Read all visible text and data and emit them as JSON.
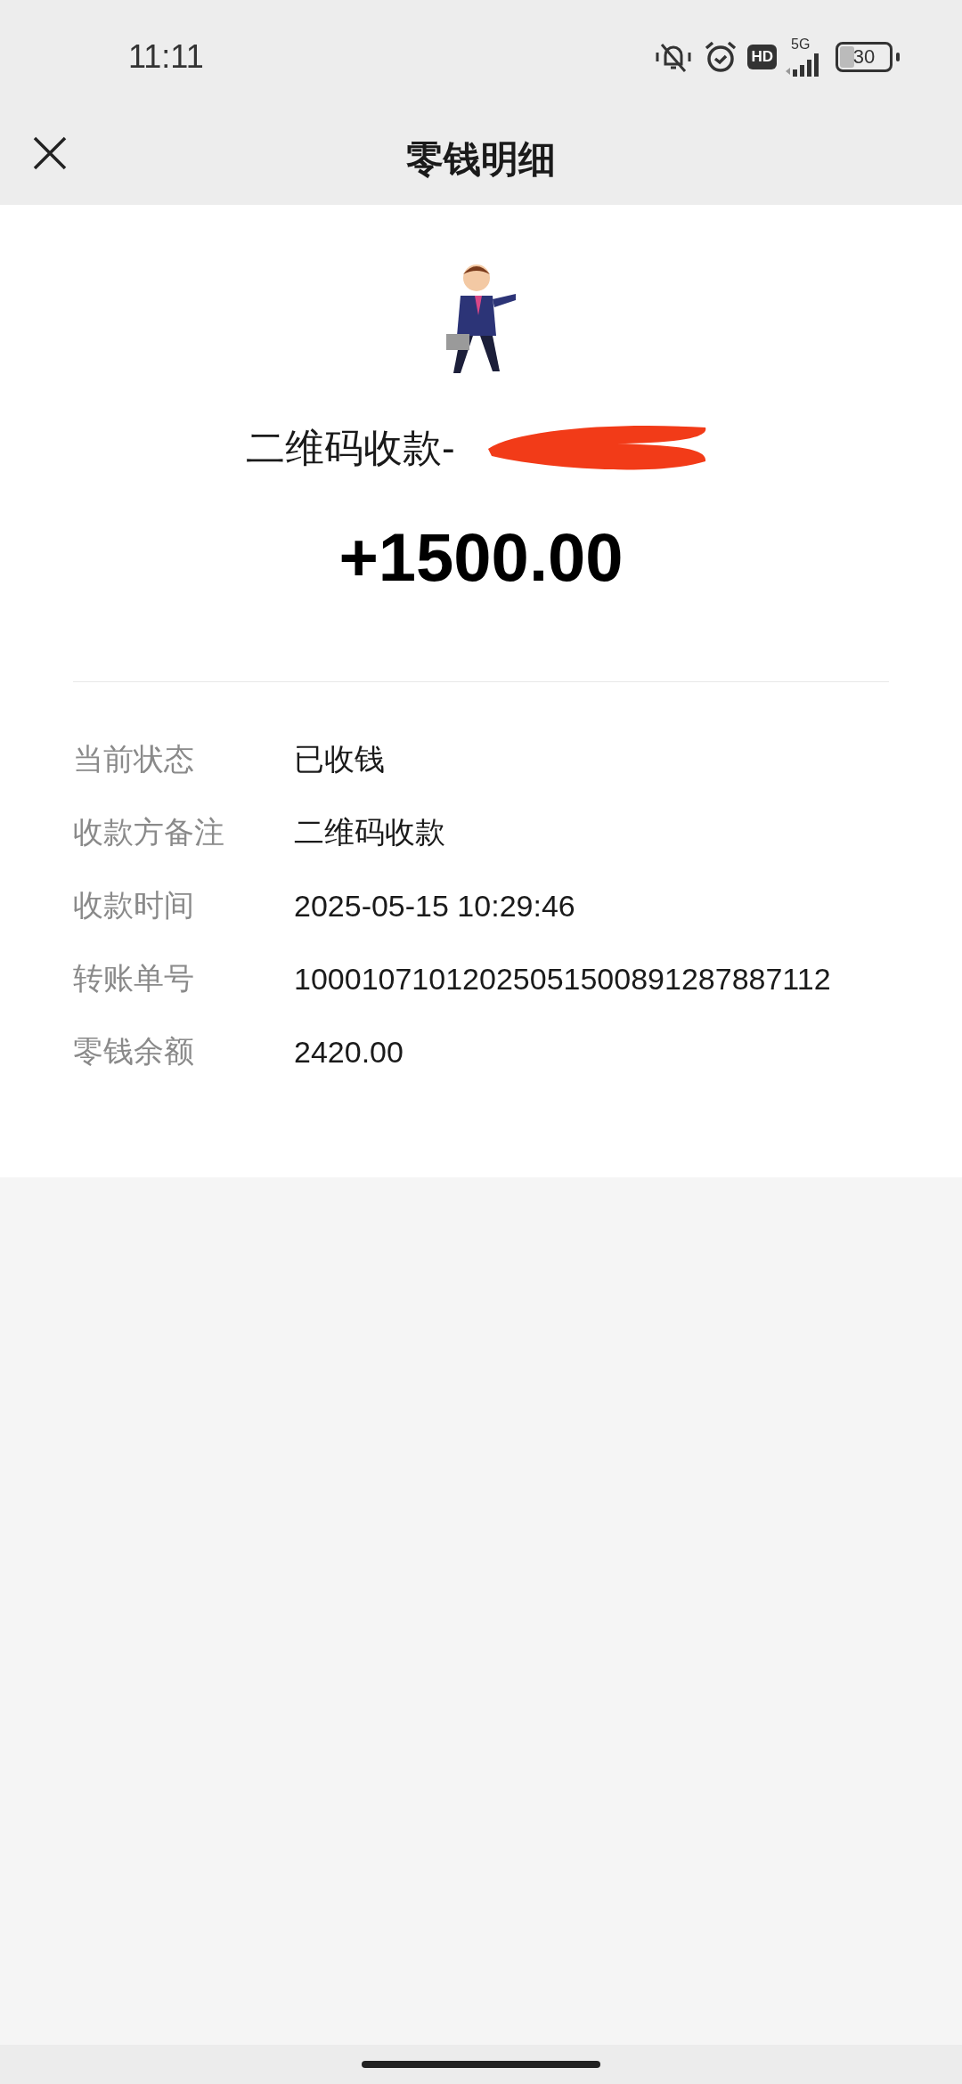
{
  "status_bar": {
    "time": "11:11",
    "hd_badge": "HD",
    "network": "5G",
    "battery": "30"
  },
  "nav": {
    "title": "零钱明细"
  },
  "transaction": {
    "title": "二维码收款-",
    "amount": "+1500.00"
  },
  "details": [
    {
      "label": "当前状态",
      "value": "已收钱"
    },
    {
      "label": "收款方备注",
      "value": "二维码收款"
    },
    {
      "label": "收款时间",
      "value": "2025-05-15 10:29:46"
    },
    {
      "label": "转账单号",
      "value": "10001071012025051500891287887112"
    },
    {
      "label": "零钱余额",
      "value": "2420.00"
    }
  ]
}
